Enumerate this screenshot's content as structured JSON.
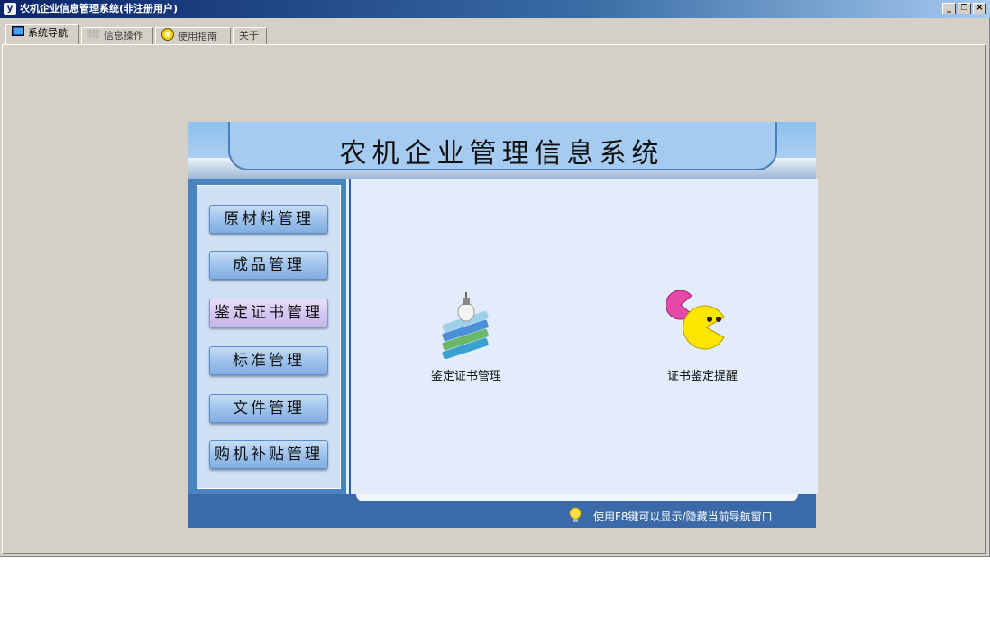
{
  "window": {
    "title": "农机企业信息管理系统(非注册用户)",
    "controls": {
      "minimize": "_",
      "restore": "🗗",
      "close": "×"
    }
  },
  "tabs": [
    {
      "label": "系统导航",
      "icon": "monitor-icon",
      "active": true
    },
    {
      "label": "信息操作",
      "icon": "grid-icon",
      "active": false
    },
    {
      "label": "使用指南",
      "icon": "help-icon",
      "active": false
    },
    {
      "label": "关于",
      "icon": "",
      "active": false
    }
  ],
  "panel": {
    "title": "农机企业管理信息系统",
    "menu": [
      {
        "label": "原材料管理"
      },
      {
        "label": "成品管理"
      },
      {
        "label": "鉴定证书管理",
        "selected": true
      },
      {
        "label": "标准管理"
      },
      {
        "label": "文件管理"
      },
      {
        "label": "购机补贴管理"
      }
    ],
    "features": [
      {
        "label": "鉴定证书管理",
        "icon": "books-lightbulb-icon"
      },
      {
        "label": "证书鉴定提醒",
        "icon": "pacman-icon"
      }
    ],
    "footer_hint": "使用F8键可以显示/隐藏当前导航窗口"
  },
  "colors": {
    "titlebar": "#0a246a",
    "window_bg": "#d4d0c8",
    "panel_header": "#a5cbf1",
    "nav_frame": "#4a83c2",
    "footer": "#3a6ba8"
  }
}
